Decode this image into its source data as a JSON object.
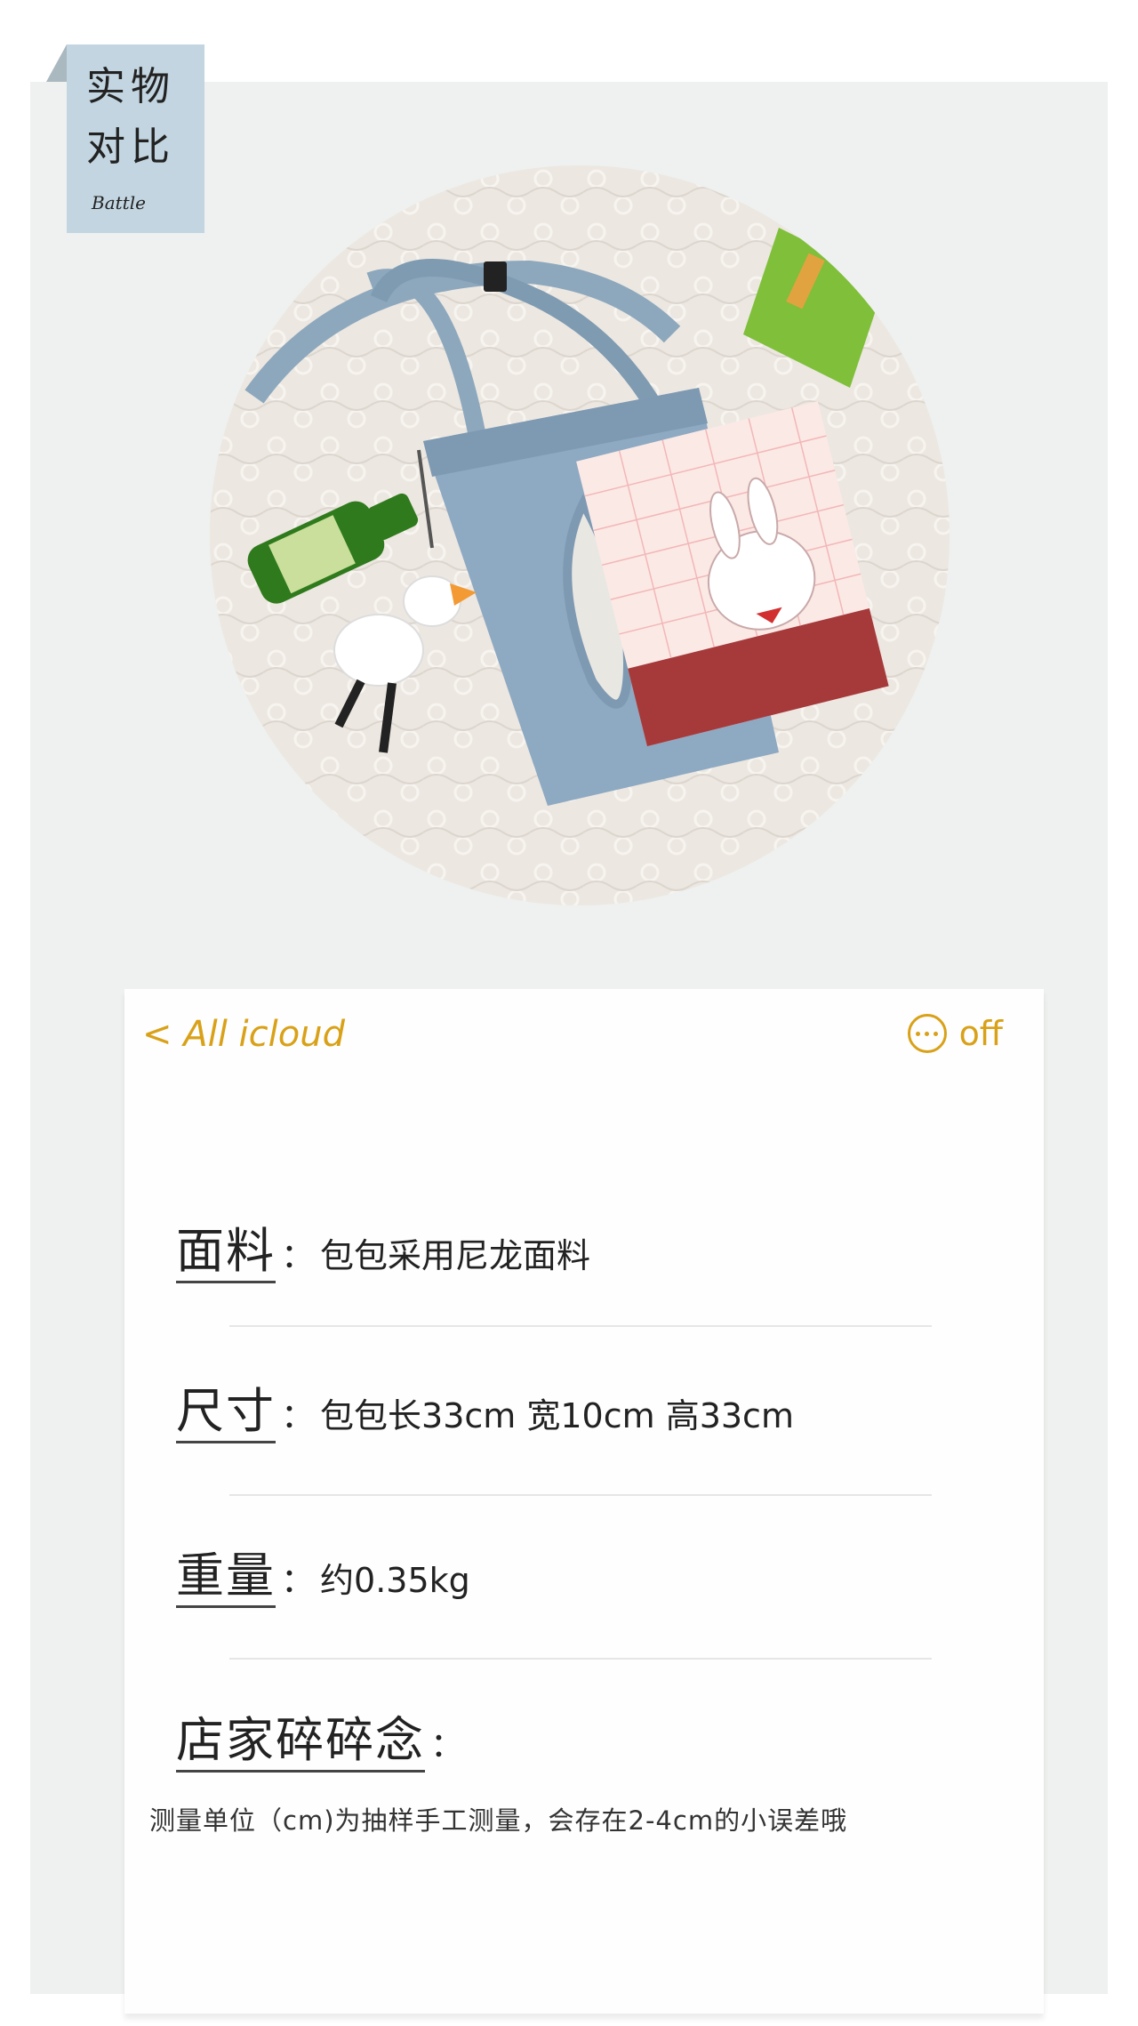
{
  "badge": {
    "line1": "实物",
    "line2": "对比",
    "sub": "Battle"
  },
  "card": {
    "back_label": "< All icloud",
    "off_label": "off",
    "specs": [
      {
        "label": "面料",
        "sep": "：",
        "value": "包包采用尼龙面料"
      },
      {
        "label": "尺寸",
        "sep": "：",
        "value": "包包长33cm 宽10cm 高33cm"
      },
      {
        "label": "重量",
        "sep": "：",
        "value": "约0.35kg"
      },
      {
        "label": "店家碎碎念",
        "sep": "：",
        "value": ""
      }
    ],
    "note": "测量单位（cm)为抽样手工测量，会存在2-4cm的小误差哦"
  },
  "colors": {
    "accent": "#d9a118",
    "badge_bg": "#c2d5e0",
    "panel_bg": "#eef1ef"
  },
  "icons": [
    "more-icon",
    "bottle-icon",
    "duck-icon",
    "notebook-icon",
    "chips-icon"
  ],
  "photo_alt": ""
}
